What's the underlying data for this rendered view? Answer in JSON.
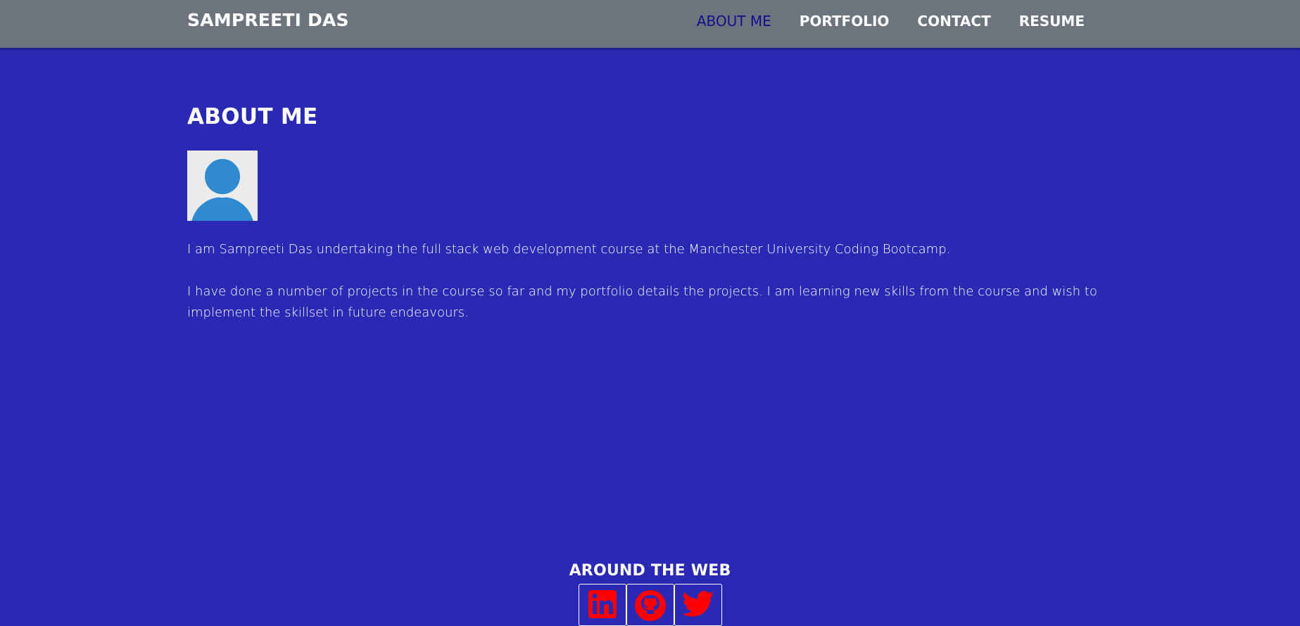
{
  "header": {
    "brand": "SAMPREETI DAS",
    "nav": [
      {
        "label": "ABOUT ME",
        "active": true
      },
      {
        "label": "PORTFOLIO",
        "active": false
      },
      {
        "label": "CONTACT",
        "active": false
      },
      {
        "label": "RESUME",
        "active": false
      }
    ]
  },
  "main": {
    "title": "ABOUT ME",
    "avatar_icon": "user-avatar-icon",
    "paragraphs": [
      "I am Sampreeti Das undertaking the full stack web development course at the Manchester University Coding Bootcamp.",
      "I have done a number of projects in the course so far and my portfolio details the projects. I am learning new skills from the course and wish to implement the skillset in future endeavours."
    ]
  },
  "footer": {
    "title": "AROUND THE WEB",
    "socials": [
      {
        "icon": "linkedin-icon"
      },
      {
        "icon": "github-icon"
      },
      {
        "icon": "twitter-icon"
      }
    ]
  },
  "colors": {
    "background": "#2929b4",
    "navbar": "#6c757d",
    "active_link": "#10108a",
    "social_icon": "#ff0000",
    "avatar": "#2f8ad0"
  }
}
